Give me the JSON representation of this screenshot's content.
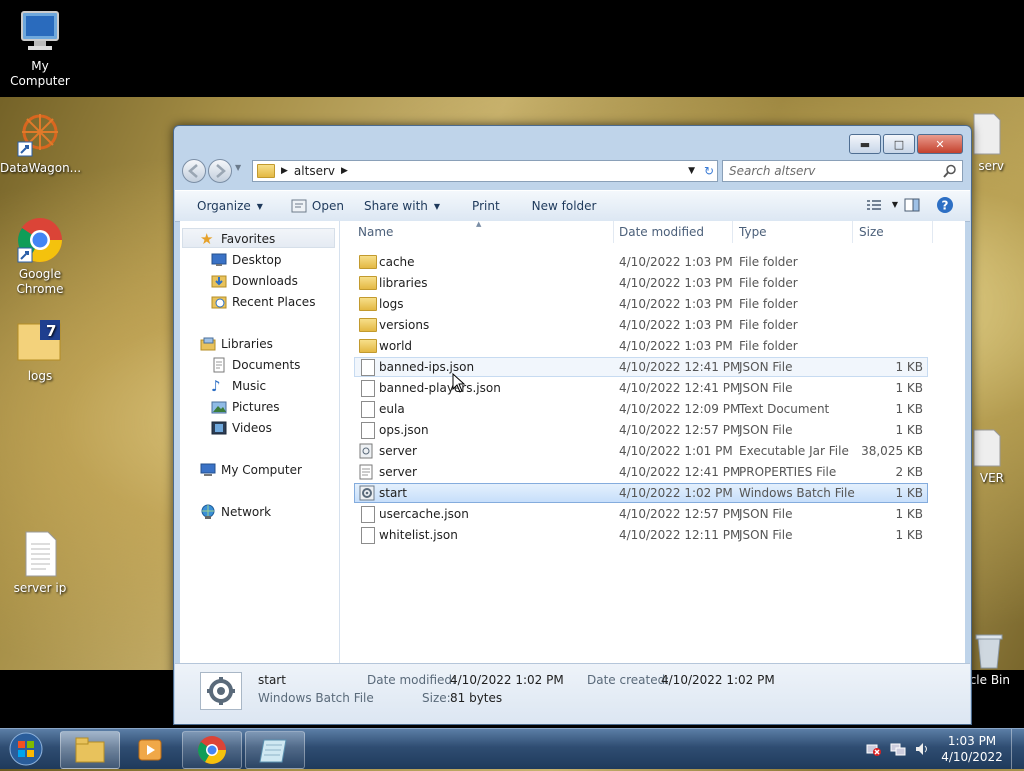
{
  "desktop": {
    "icons": [
      {
        "label": "My Computer"
      },
      {
        "label": "DataWagon..."
      },
      {
        "label": "Google Chrome"
      },
      {
        "label": "logs"
      },
      {
        "label": "server ip"
      },
      {
        "label": "serv"
      },
      {
        "label": "VER"
      },
      {
        "label": "cle Bin"
      }
    ]
  },
  "window": {
    "breadcrumb": "altserv",
    "search_placeholder": "Search altserv",
    "toolbar": {
      "organize": "Organize",
      "open": "Open",
      "share_with": "Share with",
      "print": "Print",
      "new_folder": "New folder"
    },
    "nav": {
      "favorites": "Favorites",
      "desktop": "Desktop",
      "downloads": "Downloads",
      "recent_places": "Recent Places",
      "libraries": "Libraries",
      "documents": "Documents",
      "music": "Music",
      "pictures": "Pictures",
      "videos": "Videos",
      "my_computer": "My Computer",
      "network": "Network"
    },
    "columns": {
      "name": "Name",
      "date": "Date modified",
      "type": "Type",
      "size": "Size"
    },
    "files": [
      {
        "name": "cache",
        "date": "4/10/2022 1:03 PM",
        "type": "File folder",
        "size": "",
        "kind": "folder"
      },
      {
        "name": "libraries",
        "date": "4/10/2022 1:03 PM",
        "type": "File folder",
        "size": "",
        "kind": "folder"
      },
      {
        "name": "logs",
        "date": "4/10/2022 1:03 PM",
        "type": "File folder",
        "size": "",
        "kind": "folder"
      },
      {
        "name": "versions",
        "date": "4/10/2022 1:03 PM",
        "type": "File folder",
        "size": "",
        "kind": "folder"
      },
      {
        "name": "world",
        "date": "4/10/2022 1:03 PM",
        "type": "File folder",
        "size": "",
        "kind": "folder"
      },
      {
        "name": "banned-ips.json",
        "date": "4/10/2022 12:41 PM",
        "type": "JSON File",
        "size": "1 KB",
        "kind": "file"
      },
      {
        "name": "banned-players.json",
        "date": "4/10/2022 12:41 PM",
        "type": "JSON File",
        "size": "1 KB",
        "kind": "file"
      },
      {
        "name": "eula",
        "date": "4/10/2022 12:09 PM",
        "type": "Text Document",
        "size": "1 KB",
        "kind": "file"
      },
      {
        "name": "ops.json",
        "date": "4/10/2022 12:57 PM",
        "type": "JSON File",
        "size": "1 KB",
        "kind": "file"
      },
      {
        "name": "server",
        "date": "4/10/2022 1:01 PM",
        "type": "Executable Jar File",
        "size": "38,025 KB",
        "kind": "file"
      },
      {
        "name": "server",
        "date": "4/10/2022 12:41 PM",
        "type": "PROPERTIES File",
        "size": "2 KB",
        "kind": "file"
      },
      {
        "name": "start",
        "date": "4/10/2022 1:02 PM",
        "type": "Windows Batch File",
        "size": "1 KB",
        "kind": "file"
      },
      {
        "name": "usercache.json",
        "date": "4/10/2022 12:57 PM",
        "type": "JSON File",
        "size": "1 KB",
        "kind": "file"
      },
      {
        "name": "whitelist.json",
        "date": "4/10/2022 12:11 PM",
        "type": "JSON File",
        "size": "1 KB",
        "kind": "file"
      }
    ],
    "details": {
      "name": "start",
      "type": "Windows Batch File",
      "date_modified_label": "Date modified:",
      "date_modified": "4/10/2022 1:02 PM",
      "size_label": "Size:",
      "size": "81 bytes",
      "date_created_label": "Date created:",
      "date_created": "4/10/2022 1:02 PM"
    }
  },
  "taskbar": {
    "time": "1:03 PM",
    "date": "4/10/2022"
  }
}
